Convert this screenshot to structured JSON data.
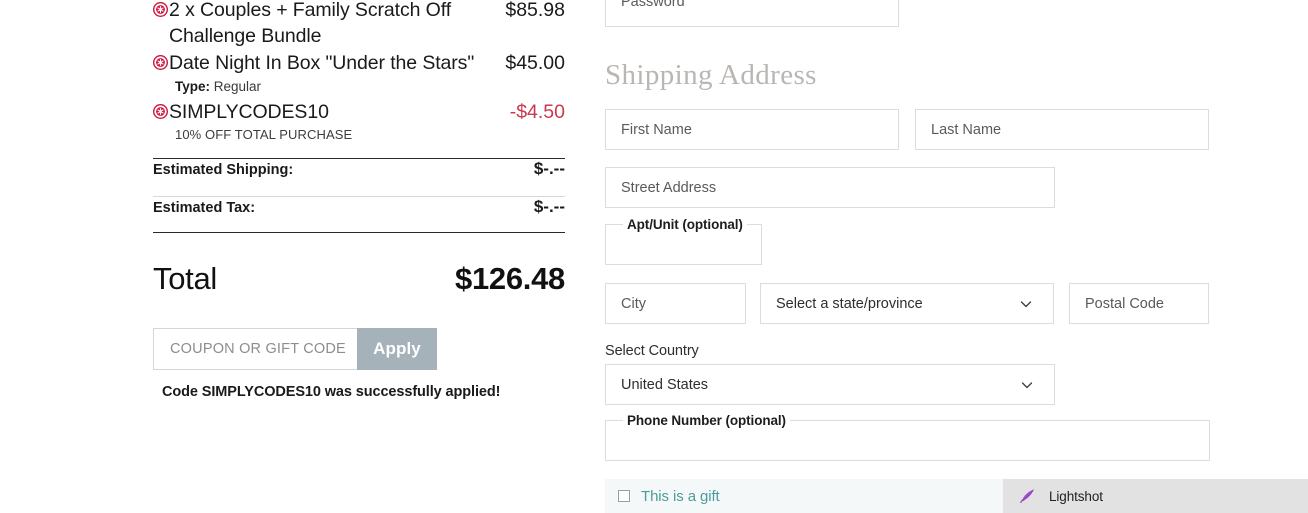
{
  "order_summary": {
    "items": [
      {
        "title": "2 x Couples + Family Scratch Off Challenge Bundle",
        "price": "$85.98",
        "remove_icon": "remove-circle-icon",
        "sub_label": "",
        "sub_value": ""
      },
      {
        "title": "Date Night In Box \"Under the Stars\"",
        "price": "$45.00",
        "remove_icon": "remove-circle-icon",
        "sub_label": "Type:",
        "sub_value": " Regular"
      },
      {
        "title": "SIMPLYCODES10",
        "price": "-$4.50",
        "remove_icon": "remove-circle-icon",
        "sub_caption": "10% OFF TOTAL PURCHASE"
      }
    ],
    "estimated_shipping_label": "Estimated Shipping:",
    "estimated_shipping_value": "$-.--",
    "estimated_tax_label": "Estimated Tax:",
    "estimated_tax_value": "$-.--",
    "total_label": "Total",
    "total_value": "$126.48",
    "discount_color": "#c73a52",
    "remove_icon_color": "#d2143c"
  },
  "coupon": {
    "placeholder": "COUPON OR GIFT CODE",
    "value": "",
    "apply_label": "Apply",
    "apply_bg": "#a6b2ba",
    "success_message": "Code SIMPLYCODES10 was successfully applied!"
  },
  "account": {
    "password_placeholder": "Password",
    "password_value": ""
  },
  "shipping": {
    "heading": "Shipping Address",
    "first_name_placeholder": "First Name",
    "first_name_value": "",
    "last_name_placeholder": "Last Name",
    "last_name_value": "",
    "street_placeholder": "Street Address",
    "street_value": "",
    "apt_label": "Apt/Unit (optional)",
    "apt_value": "",
    "city_placeholder": "City",
    "city_value": "",
    "state_selected": "Select a state/province",
    "postal_placeholder": "Postal Code",
    "postal_value": "",
    "country_label": "Select Country",
    "country_selected": "United States",
    "phone_label": "Phone Number (optional)",
    "phone_value": "",
    "chevron_icon": "chevron-down-icon"
  },
  "gift": {
    "label": "This is a gift",
    "checked": false,
    "label_color": "#4a9d9c",
    "background": "#f5f8f8"
  },
  "lightshot": {
    "label": "Lightshot",
    "icon": "feather-icon",
    "background": "#e2e2e2",
    "icon_color": "#9b4fc8"
  }
}
